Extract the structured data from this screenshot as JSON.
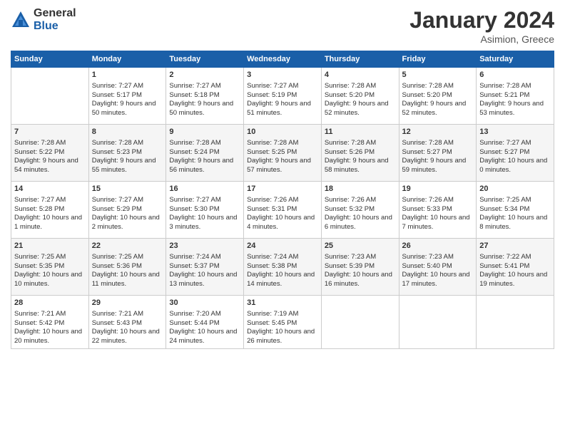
{
  "logo": {
    "general": "General",
    "blue": "Blue"
  },
  "title": "January 2024",
  "location": "Asimion, Greece",
  "days_header": [
    "Sunday",
    "Monday",
    "Tuesday",
    "Wednesday",
    "Thursday",
    "Friday",
    "Saturday"
  ],
  "weeks": [
    [
      {
        "day": "",
        "sunrise": "",
        "sunset": "",
        "daylight": ""
      },
      {
        "day": "1",
        "sunrise": "Sunrise: 7:27 AM",
        "sunset": "Sunset: 5:17 PM",
        "daylight": "Daylight: 9 hours and 50 minutes."
      },
      {
        "day": "2",
        "sunrise": "Sunrise: 7:27 AM",
        "sunset": "Sunset: 5:18 PM",
        "daylight": "Daylight: 9 hours and 50 minutes."
      },
      {
        "day": "3",
        "sunrise": "Sunrise: 7:27 AM",
        "sunset": "Sunset: 5:19 PM",
        "daylight": "Daylight: 9 hours and 51 minutes."
      },
      {
        "day": "4",
        "sunrise": "Sunrise: 7:28 AM",
        "sunset": "Sunset: 5:20 PM",
        "daylight": "Daylight: 9 hours and 52 minutes."
      },
      {
        "day": "5",
        "sunrise": "Sunrise: 7:28 AM",
        "sunset": "Sunset: 5:20 PM",
        "daylight": "Daylight: 9 hours and 52 minutes."
      },
      {
        "day": "6",
        "sunrise": "Sunrise: 7:28 AM",
        "sunset": "Sunset: 5:21 PM",
        "daylight": "Daylight: 9 hours and 53 minutes."
      }
    ],
    [
      {
        "day": "7",
        "sunrise": "Sunrise: 7:28 AM",
        "sunset": "Sunset: 5:22 PM",
        "daylight": "Daylight: 9 hours and 54 minutes."
      },
      {
        "day": "8",
        "sunrise": "Sunrise: 7:28 AM",
        "sunset": "Sunset: 5:23 PM",
        "daylight": "Daylight: 9 hours and 55 minutes."
      },
      {
        "day": "9",
        "sunrise": "Sunrise: 7:28 AM",
        "sunset": "Sunset: 5:24 PM",
        "daylight": "Daylight: 9 hours and 56 minutes."
      },
      {
        "day": "10",
        "sunrise": "Sunrise: 7:28 AM",
        "sunset": "Sunset: 5:25 PM",
        "daylight": "Daylight: 9 hours and 57 minutes."
      },
      {
        "day": "11",
        "sunrise": "Sunrise: 7:28 AM",
        "sunset": "Sunset: 5:26 PM",
        "daylight": "Daylight: 9 hours and 58 minutes."
      },
      {
        "day": "12",
        "sunrise": "Sunrise: 7:28 AM",
        "sunset": "Sunset: 5:27 PM",
        "daylight": "Daylight: 9 hours and 59 minutes."
      },
      {
        "day": "13",
        "sunrise": "Sunrise: 7:27 AM",
        "sunset": "Sunset: 5:27 PM",
        "daylight": "Daylight: 10 hours and 0 minutes."
      }
    ],
    [
      {
        "day": "14",
        "sunrise": "Sunrise: 7:27 AM",
        "sunset": "Sunset: 5:28 PM",
        "daylight": "Daylight: 10 hours and 1 minute."
      },
      {
        "day": "15",
        "sunrise": "Sunrise: 7:27 AM",
        "sunset": "Sunset: 5:29 PM",
        "daylight": "Daylight: 10 hours and 2 minutes."
      },
      {
        "day": "16",
        "sunrise": "Sunrise: 7:27 AM",
        "sunset": "Sunset: 5:30 PM",
        "daylight": "Daylight: 10 hours and 3 minutes."
      },
      {
        "day": "17",
        "sunrise": "Sunrise: 7:26 AM",
        "sunset": "Sunset: 5:31 PM",
        "daylight": "Daylight: 10 hours and 4 minutes."
      },
      {
        "day": "18",
        "sunrise": "Sunrise: 7:26 AM",
        "sunset": "Sunset: 5:32 PM",
        "daylight": "Daylight: 10 hours and 6 minutes."
      },
      {
        "day": "19",
        "sunrise": "Sunrise: 7:26 AM",
        "sunset": "Sunset: 5:33 PM",
        "daylight": "Daylight: 10 hours and 7 minutes."
      },
      {
        "day": "20",
        "sunrise": "Sunrise: 7:25 AM",
        "sunset": "Sunset: 5:34 PM",
        "daylight": "Daylight: 10 hours and 8 minutes."
      }
    ],
    [
      {
        "day": "21",
        "sunrise": "Sunrise: 7:25 AM",
        "sunset": "Sunset: 5:35 PM",
        "daylight": "Daylight: 10 hours and 10 minutes."
      },
      {
        "day": "22",
        "sunrise": "Sunrise: 7:25 AM",
        "sunset": "Sunset: 5:36 PM",
        "daylight": "Daylight: 10 hours and 11 minutes."
      },
      {
        "day": "23",
        "sunrise": "Sunrise: 7:24 AM",
        "sunset": "Sunset: 5:37 PM",
        "daylight": "Daylight: 10 hours and 13 minutes."
      },
      {
        "day": "24",
        "sunrise": "Sunrise: 7:24 AM",
        "sunset": "Sunset: 5:38 PM",
        "daylight": "Daylight: 10 hours and 14 minutes."
      },
      {
        "day": "25",
        "sunrise": "Sunrise: 7:23 AM",
        "sunset": "Sunset: 5:39 PM",
        "daylight": "Daylight: 10 hours and 16 minutes."
      },
      {
        "day": "26",
        "sunrise": "Sunrise: 7:23 AM",
        "sunset": "Sunset: 5:40 PM",
        "daylight": "Daylight: 10 hours and 17 minutes."
      },
      {
        "day": "27",
        "sunrise": "Sunrise: 7:22 AM",
        "sunset": "Sunset: 5:41 PM",
        "daylight": "Daylight: 10 hours and 19 minutes."
      }
    ],
    [
      {
        "day": "28",
        "sunrise": "Sunrise: 7:21 AM",
        "sunset": "Sunset: 5:42 PM",
        "daylight": "Daylight: 10 hours and 20 minutes."
      },
      {
        "day": "29",
        "sunrise": "Sunrise: 7:21 AM",
        "sunset": "Sunset: 5:43 PM",
        "daylight": "Daylight: 10 hours and 22 minutes."
      },
      {
        "day": "30",
        "sunrise": "Sunrise: 7:20 AM",
        "sunset": "Sunset: 5:44 PM",
        "daylight": "Daylight: 10 hours and 24 minutes."
      },
      {
        "day": "31",
        "sunrise": "Sunrise: 7:19 AM",
        "sunset": "Sunset: 5:45 PM",
        "daylight": "Daylight: 10 hours and 26 minutes."
      },
      {
        "day": "",
        "sunrise": "",
        "sunset": "",
        "daylight": ""
      },
      {
        "day": "",
        "sunrise": "",
        "sunset": "",
        "daylight": ""
      },
      {
        "day": "",
        "sunrise": "",
        "sunset": "",
        "daylight": ""
      }
    ]
  ]
}
